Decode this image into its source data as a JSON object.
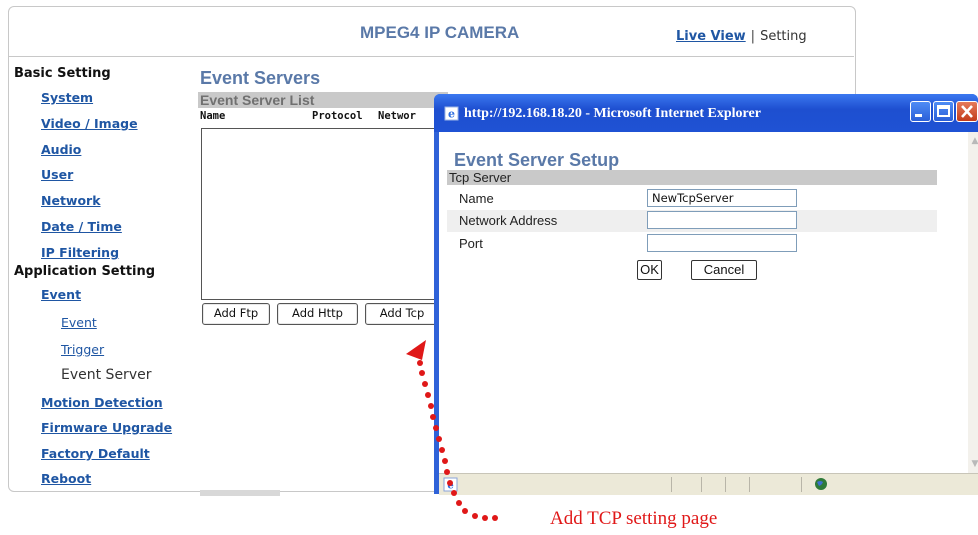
{
  "header": {
    "title": "MPEG4 IP CAMERA",
    "live_view": "Live View",
    "separator": "|",
    "setting": "Setting"
  },
  "sidebar": {
    "basic_heading": "Basic Setting",
    "system": "System",
    "video_image": "Video / Image",
    "audio": "Audio",
    "user": "User",
    "network": "Network",
    "date_time": "Date / Time",
    "ip_filtering": "IP Filtering",
    "app_heading": "Application Setting",
    "event": "Event",
    "event_sub": "Event",
    "trigger": "Trigger",
    "event_server": "Event Server",
    "motion_detection": "Motion Detection",
    "firmware_upgrade": "Firmware Upgrade",
    "factory_default": "Factory Default",
    "reboot": "Reboot"
  },
  "main": {
    "title": "Event Servers",
    "list_title": "Event Server List",
    "columns": [
      "Name",
      "Protocol",
      "Networ"
    ],
    "buttons": {
      "add_ftp": "Add Ftp",
      "add_http": "Add Http",
      "add_tcp": "Add Tcp"
    }
  },
  "popup": {
    "window_title": "http://192.168.18.20 -  Microsoft Internet Explorer",
    "setup_title": "Event Server Setup",
    "section": "Tcp Server",
    "name_label": "Name",
    "name_value": "NewTcpServer",
    "address_label": "Network Address",
    "address_value": "",
    "port_label": "Port",
    "port_value": "",
    "ok": "OK",
    "cancel": "Cancel"
  },
  "annotation": {
    "caption": "Add TCP setting page",
    "color": "#e01818"
  },
  "colors": {
    "title_blue": "#5a79a8",
    "link_blue": "#1f56a3",
    "xp_titlebar": "#1f52d4"
  }
}
